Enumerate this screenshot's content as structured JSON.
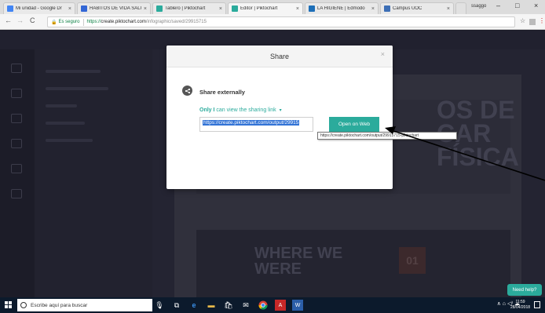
{
  "browser": {
    "tabs": [
      {
        "label": "Mi unidad - Google Dr",
        "color": "#4285f4"
      },
      {
        "label": "HÁBITOS DE VIDA SALU",
        "color": "#3367d6"
      },
      {
        "label": "Tablero | Piktochart",
        "color": "#2bab9c"
      },
      {
        "label": "Editor | Piktochart",
        "color": "#2bab9c"
      },
      {
        "label": "LA HIGIENE | Edmodo",
        "color": "#1d6fb8"
      },
      {
        "label": "Campus UOC",
        "color": "#3d6fb6"
      }
    ],
    "profile": "ssaggo",
    "window_controls": {
      "minimize": "–",
      "maximize": "□",
      "close": "×"
    },
    "nav": {
      "back": "←",
      "forward": "→",
      "reload": "C"
    },
    "omnibox": {
      "secure_label": "Es seguro",
      "url_scheme": "https://",
      "url_host": "create.piktochart.com",
      "url_path": "/infographic/saved/29915715"
    },
    "icons": {
      "star": "☆",
      "menu": "⋮"
    }
  },
  "app": {
    "canvas_text": "OS DE\nCAR\nFÍSICA",
    "where_we_were": "WHERE WE\nWERE",
    "badge": "01",
    "need_help": "Need help?"
  },
  "modal": {
    "title": "Share",
    "close": "×",
    "share_heading": "Share externally",
    "permission_only": "Only I",
    "permission_rest": "can view the sharing link",
    "permission_caret": "▾",
    "link_value": "https://create.piktochart.com/output/29915",
    "open_button": "Open on Web"
  },
  "tooltip": {
    "text": "https://create.piktochart.com/output/29915715-piktochart"
  },
  "taskbar": {
    "search_placeholder": "Escribe aquí para buscar",
    "tray": "∧ ⌂ ◁⁾ ☁",
    "time": "11:59",
    "date": "28/04/2018"
  },
  "colors": {
    "accent": "#2bab9c",
    "selection": "#3273d6"
  }
}
